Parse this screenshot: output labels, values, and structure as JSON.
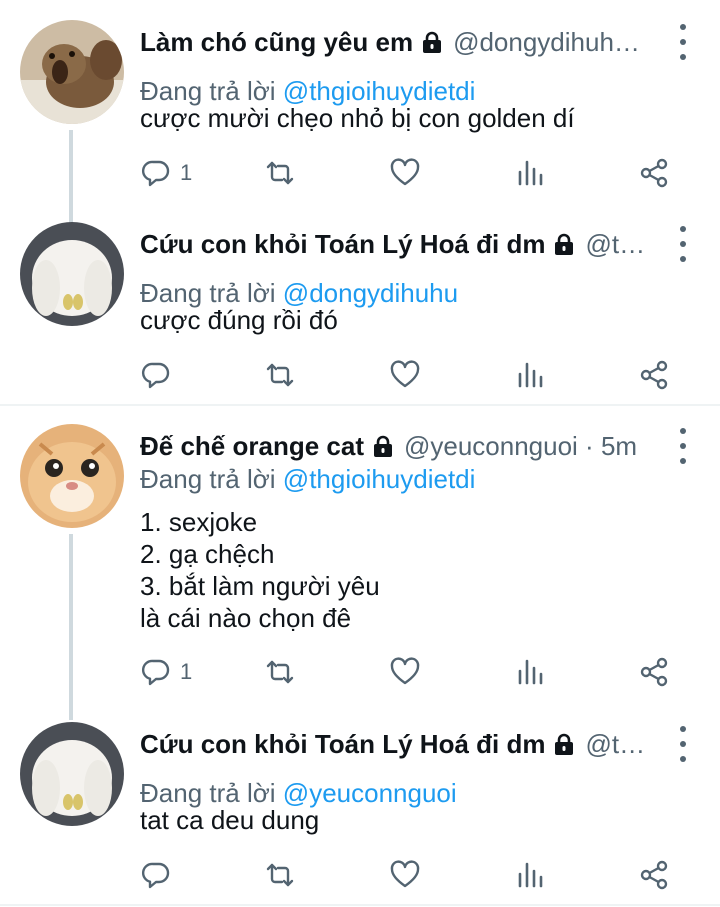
{
  "colors": {
    "link": "#1d9bf0",
    "muted": "#536471",
    "text": "#0f1419",
    "thread_line": "#cfd9de"
  },
  "icons": {
    "reply": "speech-bubble-icon",
    "retweet": "retweet-icon",
    "like": "heart-icon",
    "views": "bar-chart-icon",
    "share": "share-icon",
    "protected": "lock-icon",
    "more": "more-vertical-icon"
  },
  "tweets": [
    {
      "name": "Làm chó cũng yêu em",
      "handle": "@dongydihuh…",
      "reply_label": "Đang trả lời",
      "reply_to": "@thgioihuydietdi",
      "text": "cược mười chẹo nhỏ bị con golden dí",
      "reply_count": "1"
    },
    {
      "name": "Cứu con khỏi Toán Lý Hoá đi dm",
      "handle": "@th…",
      "reply_label": "Đang trả lời",
      "reply_to": "@dongydihuhu",
      "text": "cược đúng rồi đó",
      "reply_count": ""
    },
    {
      "name": "Đế chế orange cat",
      "handle": "@yeuconnguoi · 5m",
      "reply_label": "Đang trả lời",
      "reply_to": "@thgioihuydietdi",
      "text": "1. sexjoke\n2. gạ chệch\n3. bắt làm người yêu\nlà cái nào chọn đê",
      "reply_count": "1"
    },
    {
      "name": "Cứu con khỏi Toán Lý Hoá đi dm",
      "handle": "@th…",
      "reply_label": "Đang trả lời",
      "reply_to": "@yeuconnguoi",
      "text": "tat ca deu dung",
      "reply_count": ""
    }
  ]
}
